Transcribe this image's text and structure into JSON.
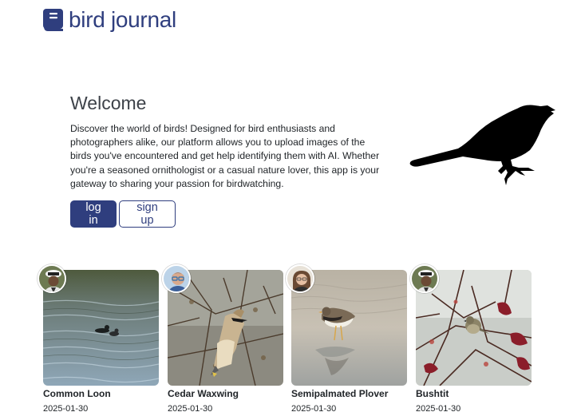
{
  "app": {
    "title": "bird journal"
  },
  "hero": {
    "heading": "Welcome",
    "description": "Discover the world of birds! Designed for bird enthusiasts and photographers alike, our platform allows you to upload images of the birds you've encountered and get help identifying them with AI. Whether you're a seasoned ornithologist or a casual nature lover, this app is your gateway to sharing your passion for birdwatching.",
    "login_label": "log in",
    "signup_label": "sign up"
  },
  "colors": {
    "brand": "#2f3e7e",
    "text": "#212529"
  },
  "posts": [
    {
      "name": "Common Loon",
      "date": "2025-01-30",
      "avatar": "user-avatar-1"
    },
    {
      "name": "Cedar Waxwing",
      "date": "2025-01-30",
      "avatar": "user-avatar-2"
    },
    {
      "name": "Semipalmated Plover",
      "date": "2025-01-30",
      "avatar": "user-avatar-3"
    },
    {
      "name": "Bushtit",
      "date": "2025-01-30",
      "avatar": "user-avatar-1"
    }
  ]
}
